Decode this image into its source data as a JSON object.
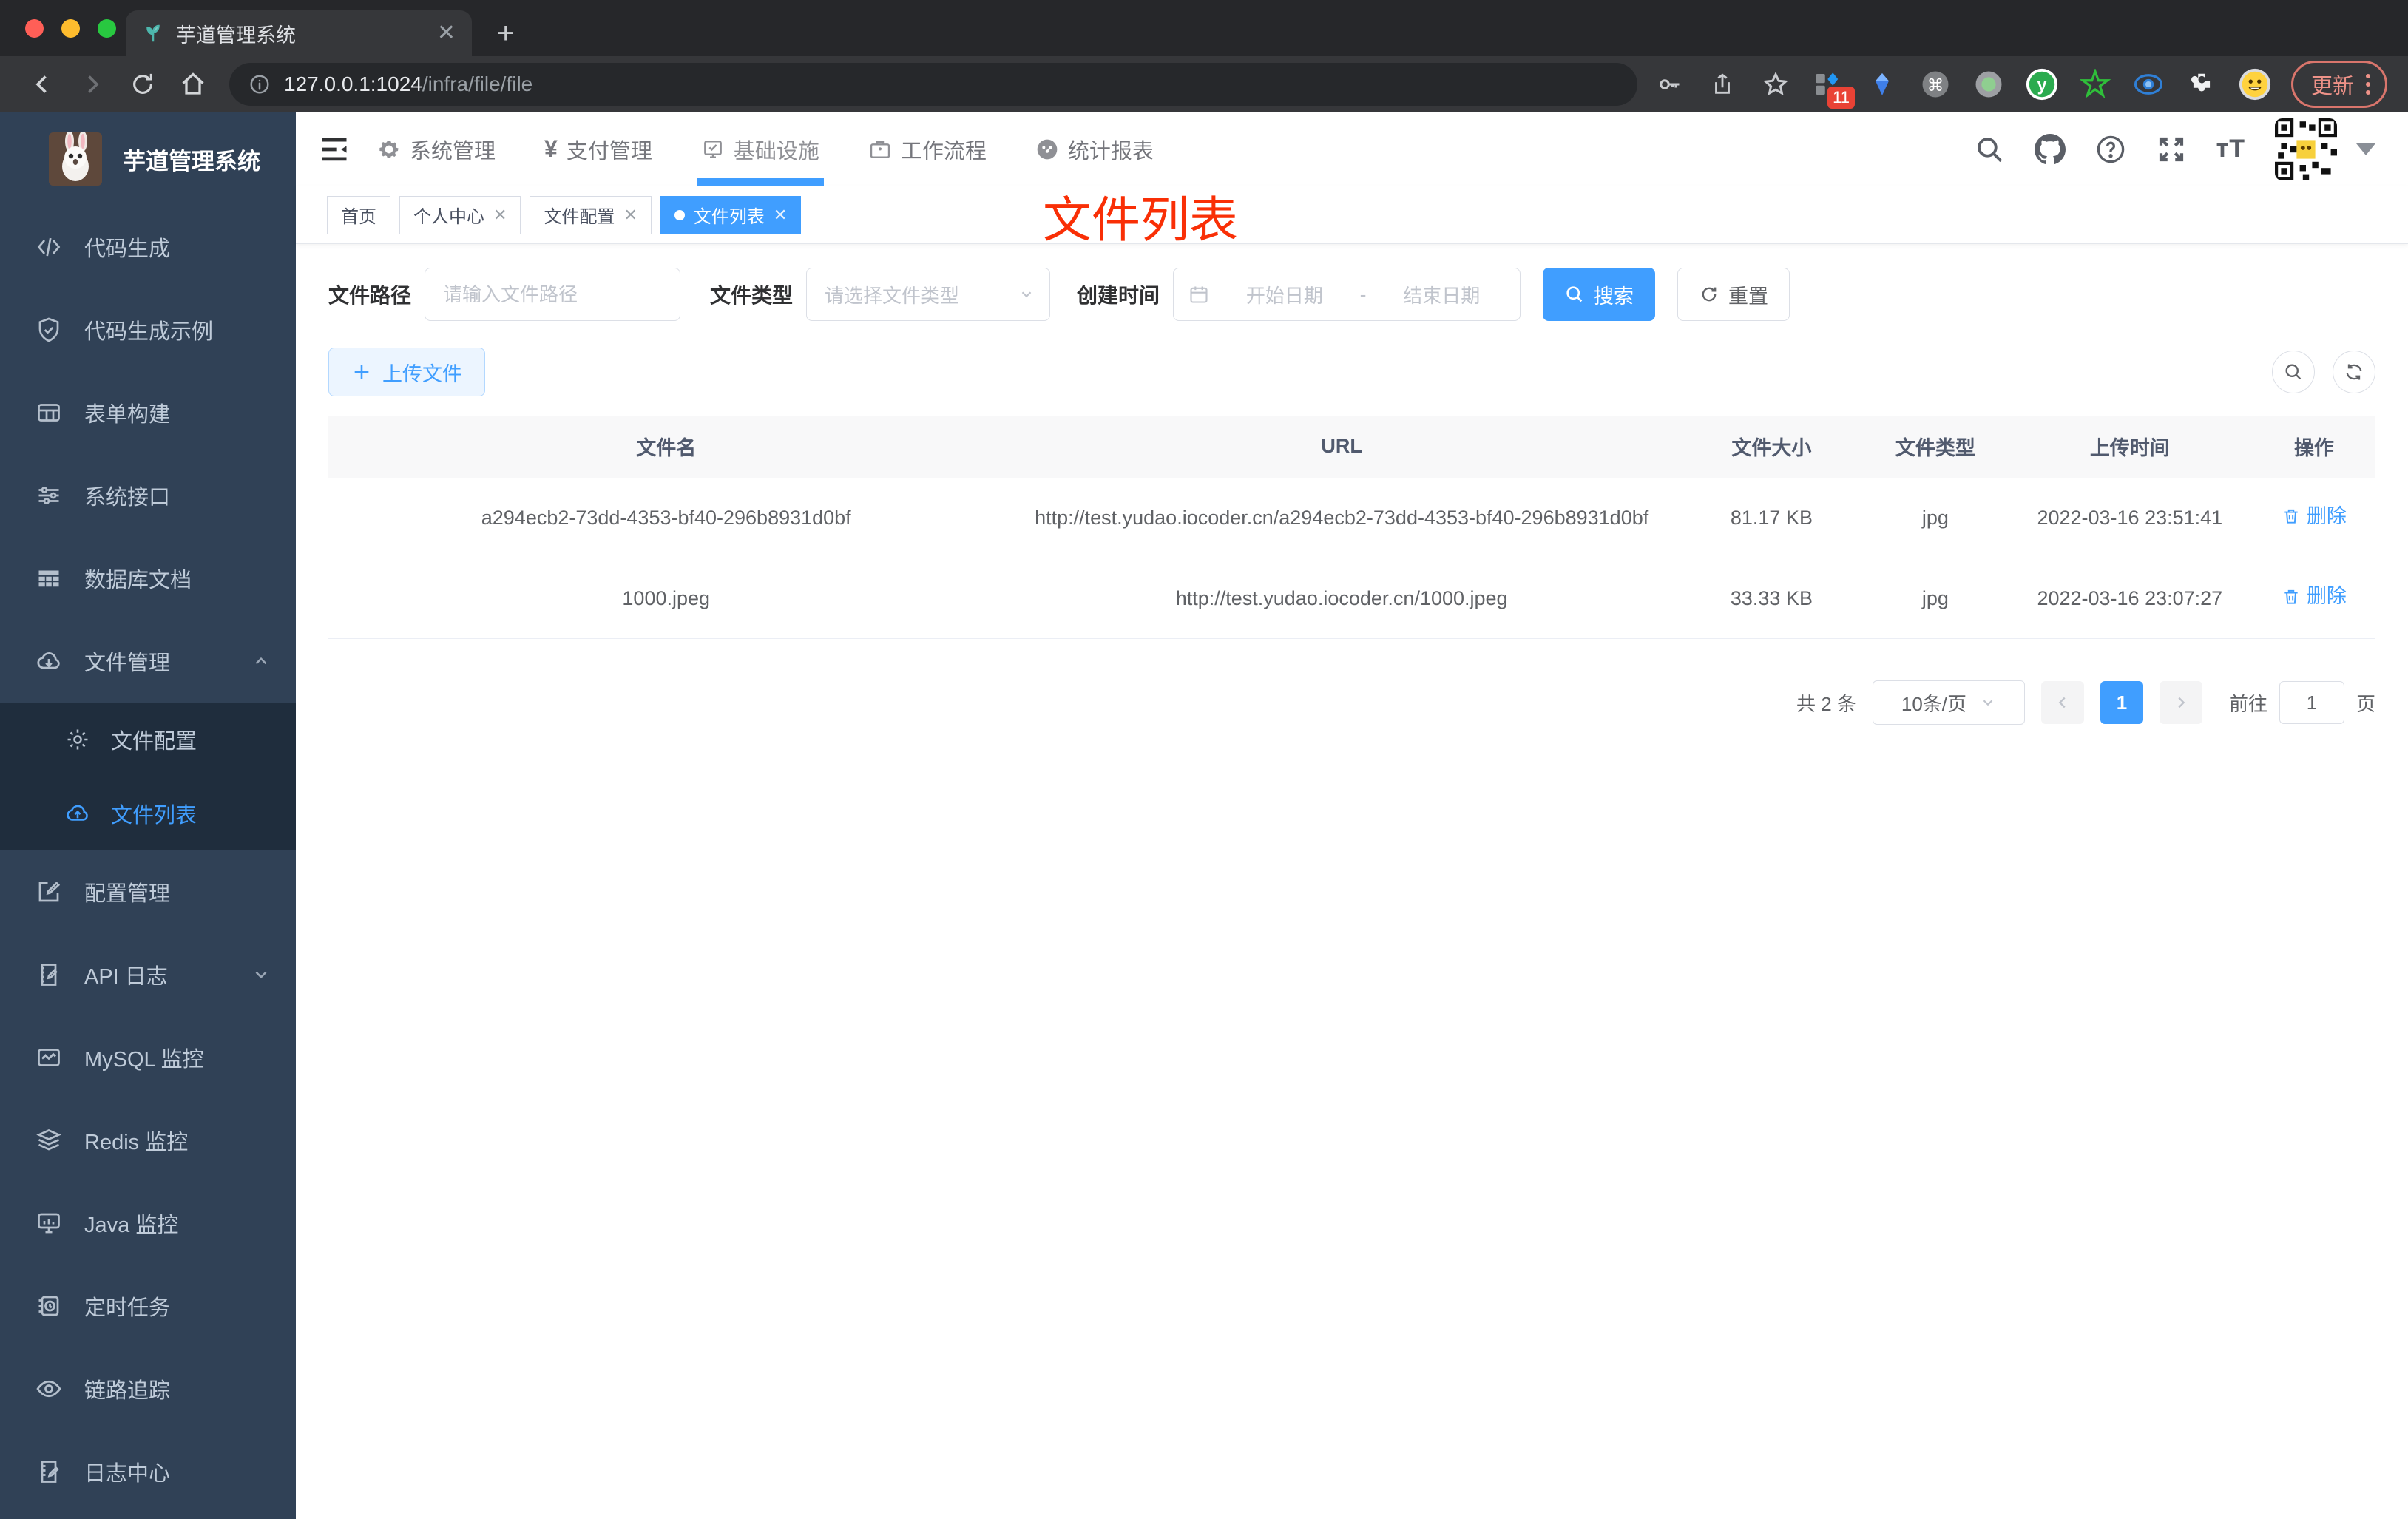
{
  "browser": {
    "tab_title": "芋道管理系统",
    "url_host": "127.0.0.1:1024",
    "url_path": "/infra/file/file",
    "new_tab_glyph": "+",
    "close_glyph": "✕",
    "update_label": "更新",
    "extension_badge": "11",
    "extensions": [
      "pinned-blue-diamond-extension",
      "blue-gem-extension",
      "command-extension",
      "recorder-extension",
      "green-y-extension",
      "green-star-extension",
      "blue-eye-extension",
      "puzzle-extension",
      "emoji-extension"
    ]
  },
  "header": {
    "nav": [
      {
        "label": "系统管理",
        "icon": "gear-icon"
      },
      {
        "label": "支付管理",
        "icon": "yen-icon"
      },
      {
        "label": "基础设施",
        "icon": "infra-icon",
        "active": true
      },
      {
        "label": "工作流程",
        "icon": "briefcase-icon"
      },
      {
        "label": "统计报表",
        "icon": "dashboard-icon"
      }
    ],
    "right_icons": [
      "search-icon",
      "github-icon",
      "question-icon",
      "fullscreen-icon",
      "font-size-icon",
      "avatar-qr",
      "caret-down-icon"
    ]
  },
  "tags": [
    {
      "label": "首页",
      "closable": false,
      "active": false
    },
    {
      "label": "个人中心",
      "closable": true,
      "active": false
    },
    {
      "label": "文件配置",
      "closable": true,
      "active": false
    },
    {
      "label": "文件列表",
      "closable": true,
      "active": true
    }
  ],
  "annotation": {
    "text": "文件列表",
    "color": "#f92f06"
  },
  "sidebar": {
    "title": "芋道管理系统",
    "items": [
      {
        "label": "代码生成",
        "icon": "code-icon"
      },
      {
        "label": "代码生成示例",
        "icon": "shield-check-icon"
      },
      {
        "label": "表单构建",
        "icon": "form-grid-icon"
      },
      {
        "label": "系统接口",
        "icon": "sliders-icon"
      },
      {
        "label": "数据库文档",
        "icon": "table-filled-icon"
      },
      {
        "label": "文件管理",
        "icon": "cloud-download-icon",
        "expanded": true,
        "submenu": [
          {
            "label": "文件配置",
            "icon": "gear-icon"
          },
          {
            "label": "文件列表",
            "icon": "cloud-upload-icon",
            "active": true
          }
        ]
      },
      {
        "label": "配置管理",
        "icon": "edit-square-icon"
      },
      {
        "label": "API 日志",
        "icon": "doc-edit-icon",
        "collapsed": true
      },
      {
        "label": "MySQL 监控",
        "icon": "chart-monitor-icon"
      },
      {
        "label": "Redis 监控",
        "icon": "layers-icon"
      },
      {
        "label": "Java 监控",
        "icon": "java-monitor-icon"
      },
      {
        "label": "定时任务",
        "icon": "schedule-icon"
      },
      {
        "label": "链路追踪",
        "icon": "eye-icon"
      },
      {
        "label": "日志中心",
        "icon": "log-edit-icon"
      }
    ]
  },
  "filter": {
    "path_label": "文件路径",
    "path_placeholder": "请输入文件路径",
    "type_label": "文件类型",
    "type_placeholder": "请选择文件类型",
    "time_label": "创建时间",
    "start_placeholder": "开始日期",
    "separator": "-",
    "end_placeholder": "结束日期",
    "search_label": "搜索",
    "reset_label": "重置"
  },
  "toolbar": {
    "upload_label": "上传文件"
  },
  "table": {
    "columns": [
      "文件名",
      "URL",
      "文件大小",
      "文件类型",
      "上传时间",
      "操作"
    ],
    "rows": [
      {
        "name": "a294ecb2-73dd-4353-bf40-296b8931d0bf",
        "url": "http://test.yudao.iocoder.cn/a294ecb2-73dd-4353-bf40-296b8931d0bf",
        "size": "81.17 KB",
        "type": "jpg",
        "time": "2022-03-16 23:51:41",
        "action": "删除"
      },
      {
        "name": "1000.jpeg",
        "url": "http://test.yudao.iocoder.cn/1000.jpeg",
        "size": "33.33 KB",
        "type": "jpg",
        "time": "2022-03-16 23:07:27",
        "action": "删除"
      }
    ]
  },
  "pagination": {
    "total": "共 2 条",
    "page_size": "10条/页",
    "page": "1",
    "goto_label": "前往",
    "goto_value": "1",
    "page_unit": "页"
  },
  "colors": {
    "accent": "#409eff",
    "sidebar_bg": "#304156",
    "submenu_bg": "#1f2d3d",
    "annotation_red": "#f92f06",
    "upload_btn_bg": "#ecf5ff",
    "table_header_bg": "#f8f8f9"
  }
}
